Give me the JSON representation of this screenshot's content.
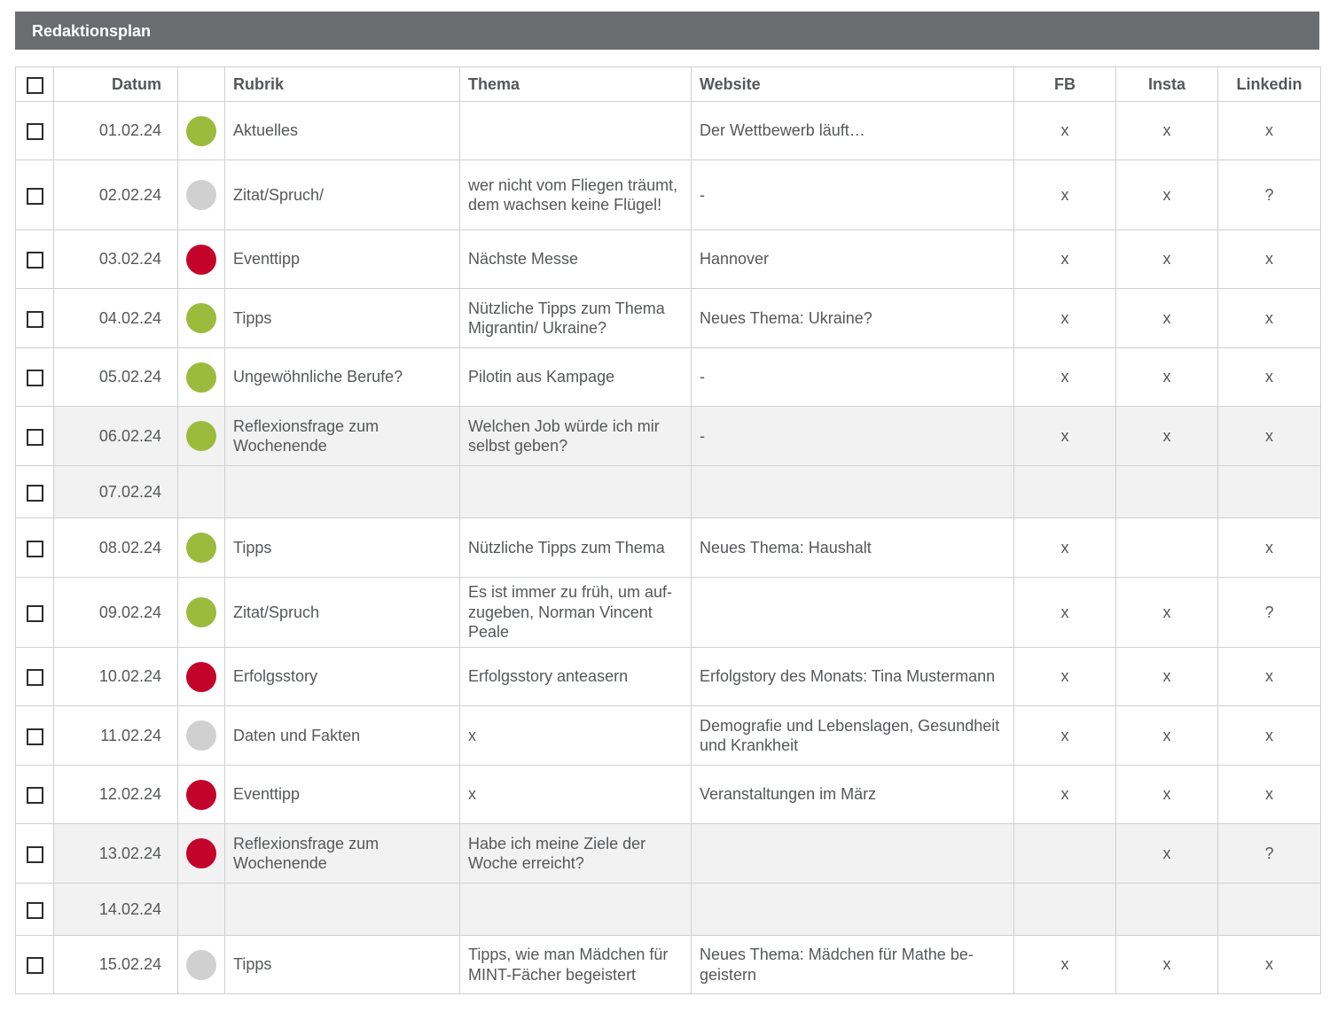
{
  "title": "Redaktionsplan",
  "colors": {
    "titlebar_bg": "#6b6c6f",
    "status_green": "#9bbb3c",
    "status_gray": "#d0d0d0",
    "status_red": "#c4032b",
    "row_shade": "#f2f2f2"
  },
  "columns": {
    "datum": "Datum",
    "rubrik": "Rubrik",
    "thema": "Thema",
    "website": "Website",
    "fb": "FB",
    "insta": "Insta",
    "linkedin": "Linkedin"
  },
  "rows": [
    {
      "datum": "01.02.24",
      "status": "green",
      "rubrik": "Aktuelles",
      "thema": "",
      "website": "Der Wettbewerb läuft…",
      "fb": "x",
      "insta": "x",
      "linkedin": "x",
      "shaded": false,
      "height": 66
    },
    {
      "datum": "02.02.24",
      "status": "gray",
      "rubrik": "Zitat/Spruch/",
      "thema": "wer nicht vom Fliegen träumt, dem wachsen keine Flügel!",
      "website": "-",
      "fb": "x",
      "insta": "x",
      "linkedin": "?",
      "shaded": false,
      "height": 79
    },
    {
      "datum": "03.02.24",
      "status": "red",
      "rubrik": "Eventtipp",
      "thema": "Nächste Messe",
      "website": "Hannover",
      "fb": "x",
      "insta": "x",
      "linkedin": "x",
      "shaded": false,
      "height": 66
    },
    {
      "datum": "04.02.24",
      "status": "green",
      "rubrik": "Tipps",
      "thema": "Nützliche Tipps zum Thema Migrantin/ Ukraine?",
      "website": "Neues  Thema: Ukraine?",
      "fb": "x",
      "insta": "x",
      "linkedin": "x",
      "shaded": false,
      "height": 67
    },
    {
      "datum": "05.02.24",
      "status": "green",
      "rubrik": "Ungewöhnliche Berufe?",
      "thema": "Pilotin aus Kampage",
      "website": "-",
      "fb": "x",
      "insta": "x",
      "linkedin": "x",
      "shaded": false,
      "height": 66
    },
    {
      "datum": "06.02.24",
      "status": "green",
      "rubrik": "Reflexionsfrage zum Wochenende",
      "thema": "Welchen Job würde ich mir selbst geben?",
      "website": "-",
      "fb": "x",
      "insta": "x",
      "linkedin": "x",
      "shaded": true,
      "height": 67
    },
    {
      "datum": "07.02.24",
      "status": "",
      "rubrik": "",
      "thema": "",
      "website": "",
      "fb": "",
      "insta": "",
      "linkedin": "",
      "shaded": true,
      "height": 59
    },
    {
      "datum": "08.02.24",
      "status": "green",
      "rubrik": "Tipps",
      "thema": "Nützliche Tipps zum Thema",
      "website": "Neues Thema: Haushalt",
      "fb": "x",
      "insta": "",
      "linkedin": "x",
      "shaded": false,
      "height": 67
    },
    {
      "datum": "09.02.24",
      "status": "green",
      "rubrik": "Zitat/Spruch",
      "thema": "Es ist immer zu früh, um auf-zugeben, Norman Vincent Peale",
      "website": "",
      "fb": "x",
      "insta": "x",
      "linkedin": "?",
      "shaded": false,
      "height": 79
    },
    {
      "datum": "10.02.24",
      "status": "red",
      "rubrik": "Erfolgsstory",
      "thema": "Erfolgsstory anteasern",
      "website": "Erfolgstory des Monats: Tina Mustermann",
      "fb": "x",
      "insta": "x",
      "linkedin": "x",
      "shaded": false,
      "height": 66
    },
    {
      "datum": "11.02.24",
      "status": "gray",
      "rubrik": "Daten und Fakten",
      "thema": "x",
      "website": "Demografie und Lebenslagen, Gesundheit und Krankheit",
      "fb": "x",
      "insta": "x",
      "linkedin": "x",
      "shaded": false,
      "height": 67
    },
    {
      "datum": "12.02.24",
      "status": "red",
      "rubrik": "Eventtipp",
      "thema": "x",
      "website": "Veranstaltungen im März",
      "fb": "x",
      "insta": "x",
      "linkedin": "x",
      "shaded": false,
      "height": 66
    },
    {
      "datum": "13.02.24",
      "status": "red",
      "rubrik": "Reflexionsfrage zum Wochenende",
      "thema": "Habe ich meine Ziele der Woche erreicht?",
      "website": "",
      "fb": "",
      "insta": "x",
      "linkedin": "?",
      "shaded": true,
      "height": 67
    },
    {
      "datum": "14.02.24",
      "status": "",
      "rubrik": "",
      "thema": "",
      "website": "",
      "fb": "",
      "insta": "",
      "linkedin": "",
      "shaded": true,
      "height": 59
    },
    {
      "datum": "15.02.24",
      "status": "gray",
      "rubrik": "Tipps",
      "thema": "Tipps, wie man Mädchen für MINT-Fächer begeistert",
      "website": "Neues Thema: Mädchen für Mathe be-geistern",
      "fb": "x",
      "insta": "x",
      "linkedin": "x",
      "shaded": false,
      "height": 66
    }
  ]
}
